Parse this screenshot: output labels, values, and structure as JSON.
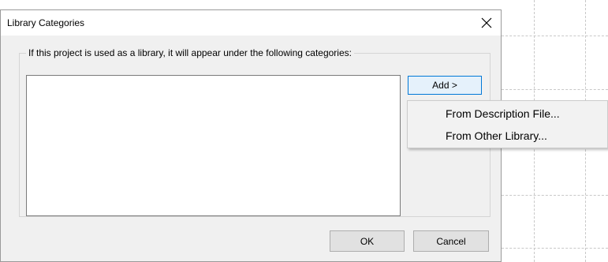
{
  "dialog": {
    "title": "Library Categories",
    "group_label": "If this project is used as a library, it will appear under the following categories:",
    "add_button": "Add >",
    "ok_button": "OK",
    "cancel_button": "Cancel",
    "close_icon": "close-icon"
  },
  "add_menu": {
    "items": [
      {
        "label": "From Description File..."
      },
      {
        "label": "From Other Library..."
      }
    ]
  },
  "colors": {
    "dialog_bg": "#f0f0f0",
    "accent": "#0078d7"
  }
}
